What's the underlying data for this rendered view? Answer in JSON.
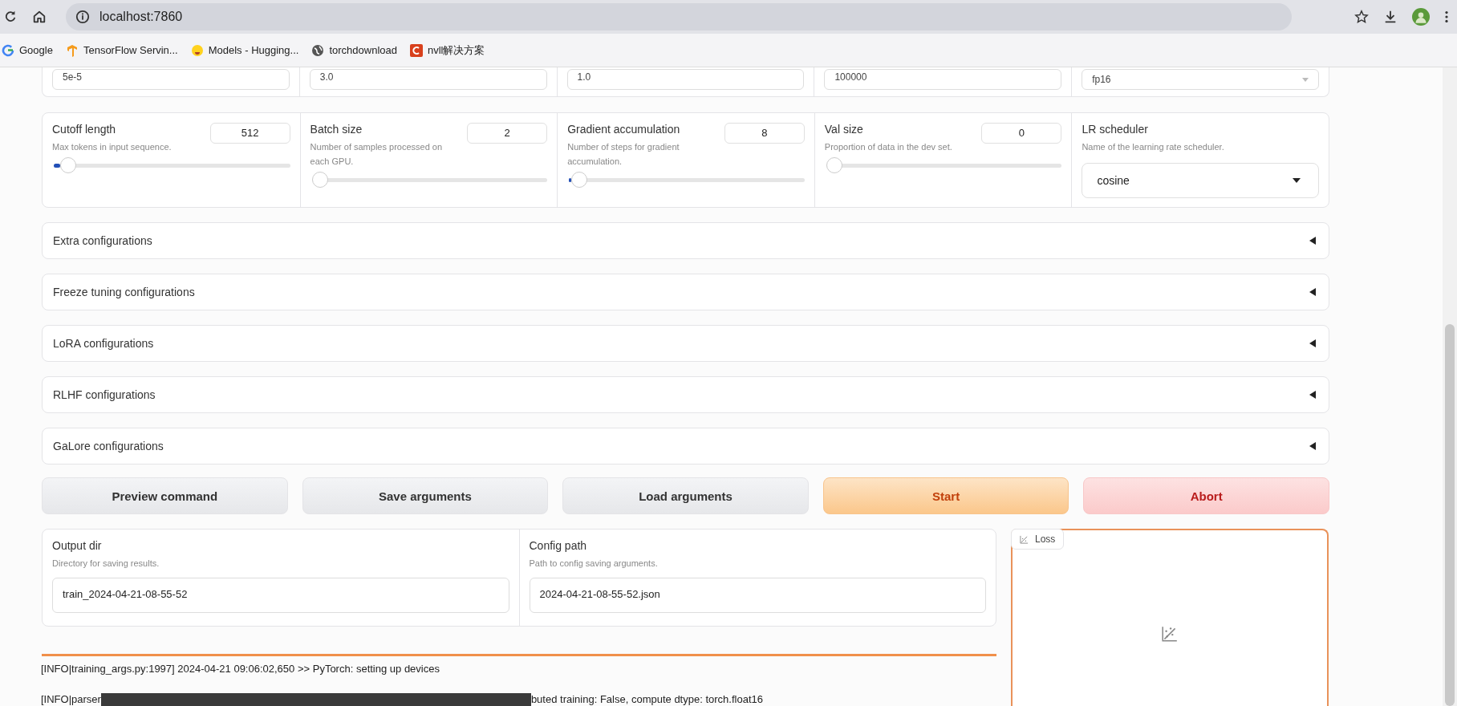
{
  "browser": {
    "url": "localhost:7860",
    "bookmarks": [
      {
        "label": "Google",
        "kind": "google"
      },
      {
        "label": "TensorFlow Servin...",
        "kind": "tensorflow"
      },
      {
        "label": "Models - Hugging...",
        "kind": "hugging"
      },
      {
        "label": "torchdownload",
        "kind": "globe"
      },
      {
        "label": "nvll解决方案",
        "kind": "csdn"
      }
    ]
  },
  "top_row": [
    {
      "value": "5e-5",
      "kind": "textbox"
    },
    {
      "value": "3.0",
      "kind": "textbox"
    },
    {
      "value": "1.0",
      "kind": "textbox"
    },
    {
      "value": "100000",
      "kind": "textbox"
    },
    {
      "value": "fp16",
      "kind": "dropdown"
    }
  ],
  "sliders": [
    {
      "label": "Cutoff length",
      "info": "Max tokens in input sequence.",
      "value": "512",
      "level": 0.03
    },
    {
      "label": "Batch size",
      "info": "Number of samples processed on each GPU.",
      "value": "2",
      "level": 0
    },
    {
      "label": "Gradient accumulation",
      "info": "Number of steps for gradient accumulation.",
      "value": "8",
      "level": 0.01
    },
    {
      "label": "Val size",
      "info": "Proportion of data in the dev set.",
      "value": "0",
      "level": 0
    }
  ],
  "scheduler": {
    "label": "LR scheduler",
    "info": "Name of the learning rate scheduler.",
    "value": "cosine"
  },
  "accordions": [
    {
      "label": "Extra configurations",
      "expanded": false
    },
    {
      "label": "Freeze tuning configurations",
      "expanded": false
    },
    {
      "label": "LoRA configurations",
      "expanded": false
    },
    {
      "label": "RLHF configurations",
      "expanded": false
    },
    {
      "label": "GaLore configurations",
      "expanded": false
    }
  ],
  "buttons": [
    {
      "label": "Preview command",
      "kind": "secondary"
    },
    {
      "label": "Save arguments",
      "kind": "secondary"
    },
    {
      "label": "Load arguments",
      "kind": "secondary"
    },
    {
      "label": "Start",
      "kind": "primary"
    },
    {
      "label": "Abort",
      "kind": "stop"
    }
  ],
  "output_dir": {
    "label": "Output dir",
    "info": "Directory for saving results.",
    "value": "train_2024-04-21-08-55-52"
  },
  "config_path": {
    "label": "Config path",
    "info": "Path to config saving arguments.",
    "value": "2024-04-21-08-55-52.json"
  },
  "loss_plot": {
    "label": "Loss"
  },
  "log": [
    {
      "parts": [
        "[INFO|training_args.py:1997] 2024-04-21 09:06:02,650 >> PyTorch: setting up devices"
      ]
    },
    {
      "parts": [
        "[INFO|parser",
        "buted training: False, compute dtype: torch.float16"
      ]
    }
  ]
}
